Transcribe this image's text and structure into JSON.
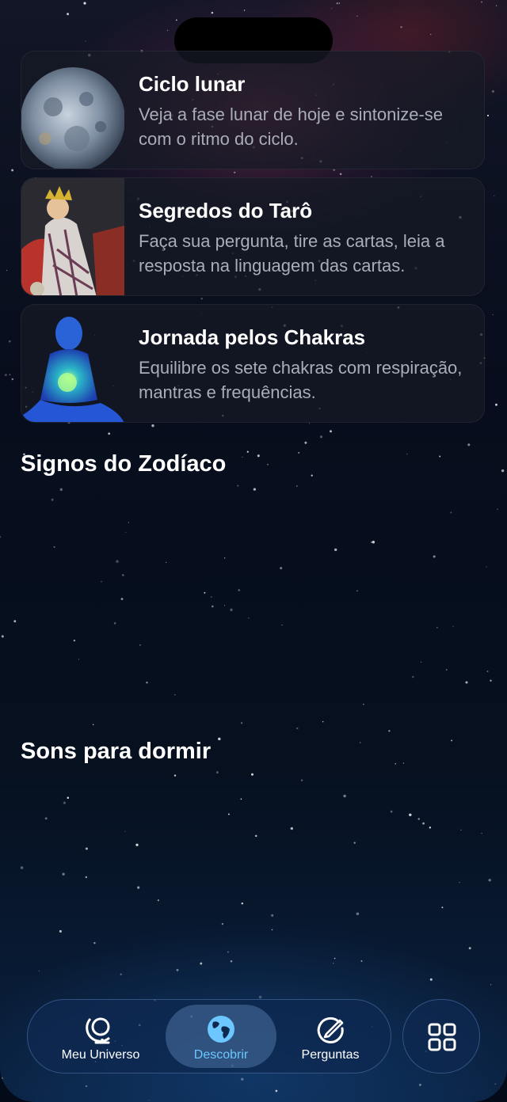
{
  "cards": [
    {
      "title": "Ciclo lunar",
      "description": "Veja a fase lunar de hoje e sintonize-se com o ritmo do ciclo.",
      "thumbnail_icon": "moon-icon"
    },
    {
      "title": "Segredos do Tarô",
      "description": "Faça sua pergunta, tire as cartas, leia a resposta na linguagem das cartas.",
      "thumbnail_icon": "tarot-card-icon"
    },
    {
      "title": "Jornada pelos Chakras",
      "description": "Equilibre os sete chakras com respiração, mantras e frequências.",
      "thumbnail_icon": "meditation-figure-icon"
    }
  ],
  "sections": {
    "zodiac_title": "Signos do Zodíaco",
    "sleep_sounds_title": "Sons para dormir"
  },
  "tabbar": {
    "tabs": [
      {
        "label": "Meu Universo",
        "icon": "globe-stand-icon",
        "active": false
      },
      {
        "label": "Descobrir",
        "icon": "earth-icon",
        "active": true
      },
      {
        "label": "Perguntas",
        "icon": "pencil-circle-icon",
        "active": false
      }
    ],
    "menu_icon": "grid-icon"
  },
  "colors": {
    "accent": "#6cc6ff",
    "card_bg": "#161a26",
    "text_primary": "#ffffff",
    "text_secondary": "#a9adb8"
  }
}
